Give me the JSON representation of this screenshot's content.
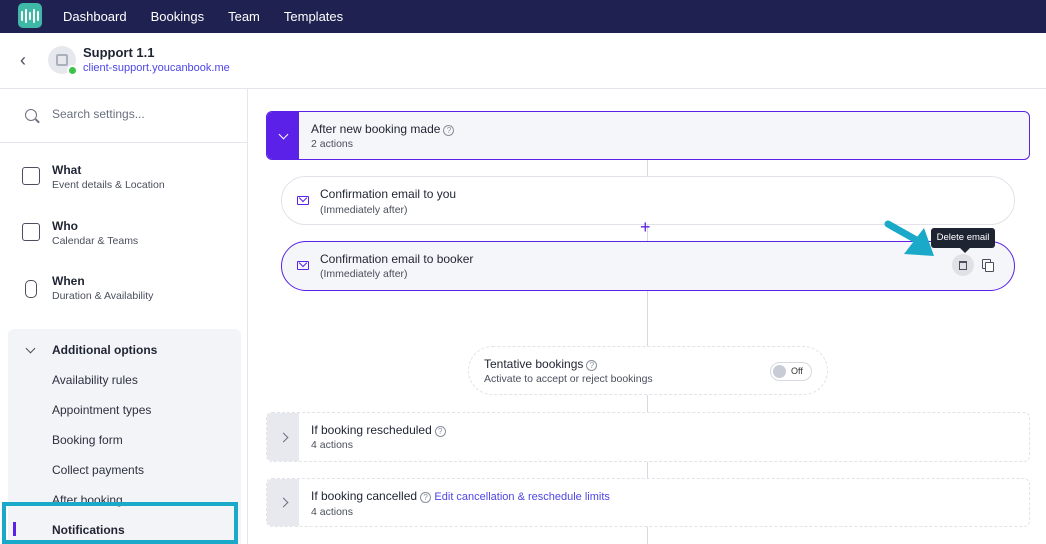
{
  "nav": {
    "items": [
      "Dashboard",
      "Bookings",
      "Team",
      "Templates"
    ]
  },
  "header": {
    "title": "Support 1.1",
    "url": "client-support.youcanbook.me"
  },
  "sidebar": {
    "search_placeholder": "Search settings...",
    "sections": [
      {
        "title": "What",
        "subtitle": "Event details & Location",
        "icon": "document-icon"
      },
      {
        "title": "Who",
        "subtitle": "Calendar & Teams",
        "icon": "calendar-icon"
      },
      {
        "title": "When",
        "subtitle": "Duration & Availability",
        "icon": "watch-icon"
      }
    ],
    "additional": {
      "title": "Additional options",
      "items": [
        "Availability rules",
        "Appointment types",
        "Booking form",
        "Collect payments",
        "After booking",
        "Notifications"
      ]
    }
  },
  "flow": {
    "after_new": {
      "title": "After new booking made",
      "sub": "2 actions"
    },
    "email_you": {
      "title": "Confirmation email to you",
      "sub": "(Immediately after)"
    },
    "email_booker": {
      "title": "Confirmation email to booker",
      "sub": "(Immediately after)"
    },
    "tooltip": "Delete email",
    "plus": "+",
    "tentative": {
      "title": "Tentative bookings",
      "sub": "Activate to accept or reject bookings",
      "toggle": "Off"
    },
    "rescheduled": {
      "title": "If booking rescheduled",
      "sub": "4 actions"
    },
    "cancelled": {
      "title": "If booking cancelled",
      "link": "Edit cancellation & reschedule limits",
      "sub": "4 actions"
    }
  },
  "colors": {
    "nav_bg": "#1f2250",
    "accent": "#5b21e8",
    "highlight": "#1aa9c8"
  }
}
